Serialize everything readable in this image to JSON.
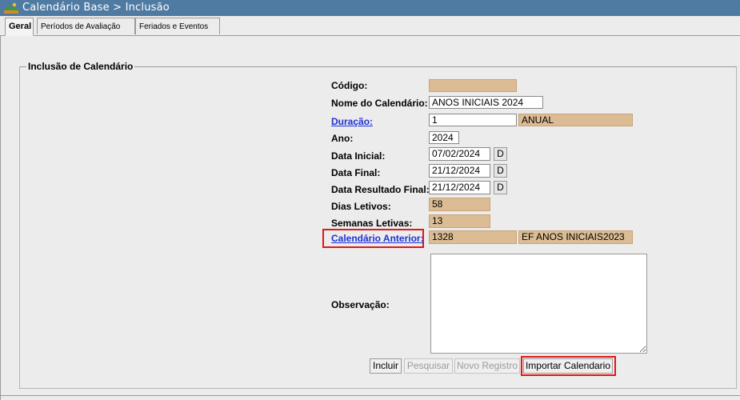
{
  "window": {
    "title": "Calendário Base > Inclusão"
  },
  "tabs": [
    {
      "label": "Geral"
    },
    {
      "label": "Períodos de Avaliação"
    },
    {
      "label": "Feriados e Eventos"
    }
  ],
  "form": {
    "legend": "Inclusão de Calendário",
    "codigo": {
      "label": "Código:",
      "value": ""
    },
    "nome": {
      "label": "Nome do Calendário:",
      "value": "ANOS INICIAIS 2024"
    },
    "duracao": {
      "label": "Duração:",
      "value": "1",
      "description": "ANUAL"
    },
    "ano": {
      "label": "Ano:",
      "value": "2024"
    },
    "data_inicial": {
      "label": "Data Inicial:",
      "value": "07/02/2024",
      "btn": "D"
    },
    "data_final": {
      "label": "Data Final:",
      "value": "21/12/2024",
      "btn": "D"
    },
    "data_resultado": {
      "label": "Data Resultado Final:",
      "value": "21/12/2024",
      "btn": "D"
    },
    "dias_letivos": {
      "label": "Dias Letivos:",
      "value": "58"
    },
    "semanas_letivas": {
      "label": "Semanas Letivas:",
      "value": "13"
    },
    "calendario_anterior": {
      "label": "Calendário Anterior:",
      "value": "1328",
      "description": "EF ANOS INICIAIS2023"
    },
    "observacao": {
      "label": "Observação:",
      "value": ""
    }
  },
  "buttons": {
    "incluir": "Incluir",
    "pesquisar": "Pesquisar",
    "novo_registro": "Novo Registro",
    "importar": "Importar Calendario"
  },
  "colors": {
    "titlebar": "#4f7aa2",
    "readonly_field": "#dcbc95",
    "link": "#1f2fd6",
    "highlight": "#e01818"
  }
}
